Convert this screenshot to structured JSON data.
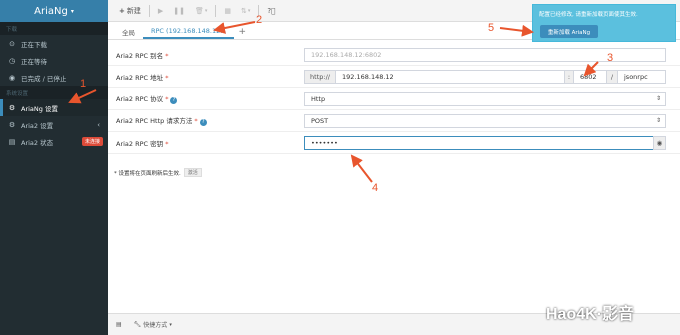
{
  "sidebar": {
    "brand": "AriaNg",
    "section_download": "下载",
    "items_download": [
      {
        "label": "正在下载",
        "icon": "play-circle-icon"
      },
      {
        "label": "正在等待",
        "icon": "clock-icon"
      },
      {
        "label": "已完成 / 已停止",
        "icon": "stop-circle-icon"
      }
    ],
    "section_settings": "系统设置",
    "items_settings": [
      {
        "label": "AriaNg 设置",
        "icon": "gear-icon"
      },
      {
        "label": "Aria2 设置",
        "icon": "gears-icon"
      },
      {
        "label": "Aria2 状态",
        "icon": "server-icon",
        "badge": "未连接"
      }
    ]
  },
  "toolbar": {
    "new_label": "新建"
  },
  "tabs": [
    {
      "label": "全局"
    },
    {
      "label": "RPC (192.168.148.12..."
    }
  ],
  "form": {
    "alias_label": "Aria2 RPC 别名",
    "alias_placeholder": "192.168.148.12:6802",
    "address_label": "Aria2 RPC 地址",
    "address_protocol": "http://",
    "address_host": "192.168.148.12",
    "address_colon": ":",
    "address_port": "6802",
    "address_slash": "/",
    "address_path": "jsonrpc",
    "protocol_label": "Aria2 RPC 协议",
    "protocol_value": "Http",
    "method_label": "Aria2 RPC Http 请求方法",
    "method_value": "POST",
    "secret_label": "Aria2 RPC 密钥",
    "secret_value": "•••••••"
  },
  "footnote": {
    "text": "* 设置将在页面刷新后生效.",
    "tag": "激活"
  },
  "bottombar": {
    "shortcut_label": "快捷方式"
  },
  "toast": {
    "message": "配置已经修改, 请重新加载页面使其生效.",
    "reload_label": "重新加载 AriaNg"
  },
  "annotations": {
    "n1": "1",
    "n2": "2",
    "n3": "3",
    "n4": "4",
    "n5": "5",
    "color": "#e8552d"
  },
  "watermark": "Hao4K·影音",
  "colors": {
    "sidebar_bg": "#222d32",
    "brand_bg": "#367fa9",
    "accent": "#3c8dbc",
    "toast_bg": "#5bc0de",
    "danger": "#dd4b39"
  }
}
